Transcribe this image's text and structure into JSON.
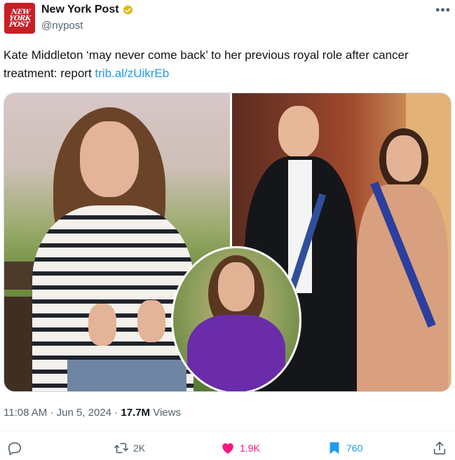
{
  "account": {
    "avatar_text": "NEW YORK POST",
    "name": "New York Post",
    "handle": "@nypost",
    "more_icon": "more-horizontal-icon"
  },
  "tweet": {
    "text": "Kate Middleton ‘may never come back’ to her previous royal role after cancer treatment: report",
    "link": "trib.al/zUikrEb"
  },
  "meta": {
    "time": "11:08 AM",
    "sep1": "·",
    "date": "Jun 5, 2024",
    "sep2": "·",
    "views_count": "17.7M",
    "views_label": "Views"
  },
  "actions": {
    "reply_count": "",
    "retweet_count": "2K",
    "like_count": "1.9K",
    "bookmark_count": "760"
  },
  "colors": {
    "accent": "#1d9bf0",
    "like": "#f91880",
    "bookmark": "#1d9bf0",
    "verified": "#e2b719",
    "brand": "#c81f25"
  }
}
